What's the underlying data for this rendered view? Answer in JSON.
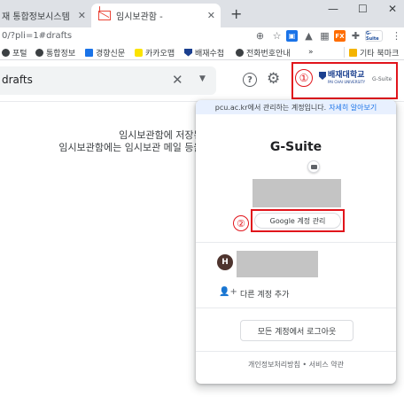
{
  "tabs": [
    {
      "label": "재 통합정보시스템"
    },
    {
      "label": "임시보관함 -"
    }
  ],
  "toolbar": {
    "address": "0/?pli=1#drafts",
    "gsuite_ext_label": "G-Suite",
    "ext_icon_label": "FX"
  },
  "bookmarks": [
    {
      "label": "포털",
      "icon": "globe-icon"
    },
    {
      "label": "통합정보",
      "icon": "globe-icon"
    },
    {
      "label": "경향신문",
      "icon": "news-icon"
    },
    {
      "label": "카카오맵",
      "icon": "kakao-icon"
    },
    {
      "label": "배재수첩",
      "icon": "university-icon"
    },
    {
      "label": "전화번호안내",
      "icon": "globe-icon"
    },
    {
      "label": "기타 북마크",
      "icon": "folder-icon"
    }
  ],
  "header": {
    "search_value": "drafts",
    "account_logo_text": "배재대학교",
    "account_logo_sub": "PAI CHAI UNIVERSITY",
    "gsuite_tag": "G-Suite",
    "marker": "①"
  },
  "main": {
    "empty_line1": "임시보관함에 저장된 메일이 없습니다.",
    "empty_line2": "임시보관함에는 임시보관 메일 등을 보관할 수 있습니"
  },
  "popup": {
    "banner_text": "pcu.ac.kr에서 관리하는 계정입니다.",
    "banner_link": "자세히 알아보기",
    "org_name": "G-Suite",
    "manage_button": "Google 계정 관리",
    "marker": "②",
    "account_initial": "H",
    "add_account": "다른 계정 추가",
    "signout": "모든 계정에서 로그아웃",
    "footer": "개인정보처리방침 • 서비스 약관"
  },
  "colors": {
    "highlight_red": "#e1141b",
    "link_blue": "#1a73e8",
    "banner_bg": "#e8f0fe"
  }
}
